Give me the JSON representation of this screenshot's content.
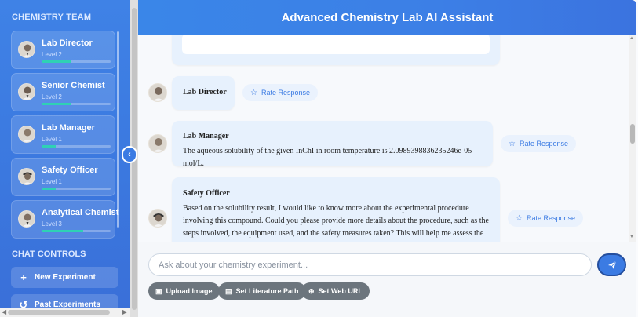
{
  "app": {
    "title": "Advanced Chemistry Lab AI Assistant"
  },
  "sidebar": {
    "team_title": "CHEMISTRY TEAM",
    "members": [
      {
        "name": "Lab Director",
        "level": "Level 2",
        "progress": 0.42
      },
      {
        "name": "Senior Chemist",
        "level": "Level 2",
        "progress": 0.42
      },
      {
        "name": "Lab Manager",
        "level": "Level 1",
        "progress": 0.2
      },
      {
        "name": "Safety Officer",
        "level": "Level 1",
        "progress": 0.2
      },
      {
        "name": "Analytical Chemist",
        "level": "Level 3",
        "progress": 0.6
      }
    ],
    "controls_title": "CHAT CONTROLS",
    "controls": [
      {
        "label": "New Experiment",
        "icon": "plus-icon"
      },
      {
        "label": "Past Experiments",
        "icon": "history-icon"
      }
    ]
  },
  "chat": {
    "messages": [
      {
        "sender": "Lab Director",
        "text": ""
      },
      {
        "sender": "Lab Manager",
        "text": "The aqueous solubility of the given InChI in room temperature is 2.0989398836235246e-05 mol/L."
      },
      {
        "sender": "Safety Officer",
        "text": "Based on the solubility result, I would like to know more about the experimental procedure involving this compound. Could you please provide more details about the procedure, such as the steps involved, the equipment used, and the safety measures taken? This will help me assess the potential"
      }
    ],
    "rate_label": "Rate Response"
  },
  "composer": {
    "placeholder": "Ask about your chemistry experiment...",
    "value": "",
    "send_icon": "paper-plane-icon",
    "actions": [
      {
        "label": "Upload Image",
        "icon": "image-icon"
      },
      {
        "label": "Set Literature Path",
        "icon": "book-icon"
      },
      {
        "label": "Set Web URL",
        "icon": "globe-icon"
      }
    ]
  },
  "colors": {
    "primary": "#3b7be3",
    "sidebar": "#3a78df",
    "accent": "#2fd1b4",
    "bubble": "#e7f1fd",
    "pill": "#6c757d"
  }
}
